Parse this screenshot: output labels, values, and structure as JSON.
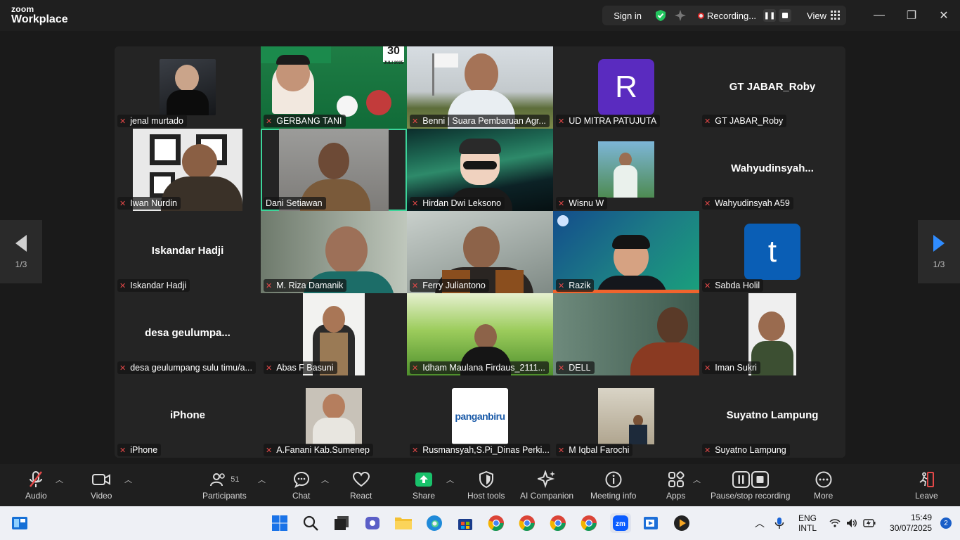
{
  "brand": {
    "line1": "zoom",
    "line2": "Workplace"
  },
  "topbar": {
    "signin": "Sign in",
    "recording": "Recording...",
    "view": "View"
  },
  "tiles": [
    {
      "name": "jenal murtado"
    },
    {
      "name": "GERBANG TANI"
    },
    {
      "name": "Benni | Suara Pembaruan Agr..."
    },
    {
      "name": "UD MITRA PATUJUTA",
      "avatar": "R"
    },
    {
      "name": "GT JABAR_Roby",
      "display": "GT JABAR_Roby"
    },
    {
      "name": "Iwan Nurdin"
    },
    {
      "name": "Dani Setiawan"
    },
    {
      "name": "Hirdan Dwi Leksono"
    },
    {
      "name": "Wisnu W"
    },
    {
      "name": "Wahyudinsyah A59",
      "display": "Wahyudinsyah..."
    },
    {
      "name": "Iskandar Hadji",
      "display": "Iskandar Hadji"
    },
    {
      "name": "M. Riza Damanik"
    },
    {
      "name": "Ferry Juliantono"
    },
    {
      "name": "Razik"
    },
    {
      "name": "Sabda Holil",
      "avatar": "t"
    },
    {
      "name": "desa geulumpang sulu timu/a...",
      "display": "desa  geulumpa..."
    },
    {
      "name": "Abas F Basuni"
    },
    {
      "name": "Idham Maulana Firdaus_2111..."
    },
    {
      "name": "DELL"
    },
    {
      "name": "Iman Sukri"
    },
    {
      "name": "iPhone",
      "display": "iPhone"
    },
    {
      "name": "A.Fanani Kab.Sumenep"
    },
    {
      "name": "Rusmansyah,S.Pi_Dinas Perki..."
    },
    {
      "name": "M Iqbal Farochi"
    },
    {
      "name": "Suyatno Lampung",
      "display": "Suyatno Lampung"
    }
  ],
  "poster": {
    "date": "30",
    "month": "JULI 2025",
    "brand": "panganbiru"
  },
  "pager": {
    "left": "1/3",
    "right": "1/3"
  },
  "toolbar": {
    "audio": "Audio",
    "video": "Video",
    "participants": "Participants",
    "participants_count": "51",
    "chat": "Chat",
    "react": "React",
    "share": "Share",
    "host_tools": "Host tools",
    "ai_companion": "AI Companion",
    "meeting_info": "Meeting info",
    "apps": "Apps",
    "pause_recording": "Pause/stop recording",
    "more": "More",
    "leave": "Leave"
  },
  "taskbar": {
    "lang1": "ENG",
    "lang2": "INTL",
    "time": "15:49",
    "date": "30/07/2025",
    "notif": "2"
  },
  "colors": {
    "accent_green": "#3cd59a",
    "mic_muted": "#e34848",
    "share_green": "#19c26b",
    "avatar_r": "#5a2bbf",
    "avatar_t": "#0a5eb5"
  }
}
